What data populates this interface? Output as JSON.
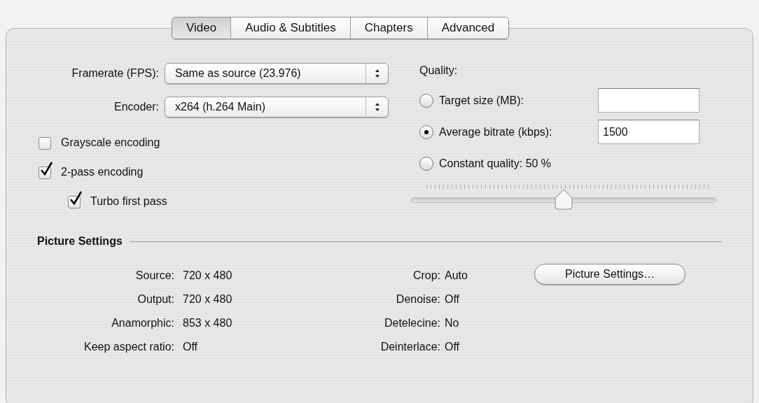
{
  "tabs": [
    {
      "label": "Video",
      "selected": true
    },
    {
      "label": "Audio & Subtitles",
      "selected": false
    },
    {
      "label": "Chapters",
      "selected": false
    },
    {
      "label": "Advanced",
      "selected": false
    }
  ],
  "popups": [
    {
      "label": "Framerate (FPS):",
      "value": "Same as source (23.976)"
    },
    {
      "label": "Encoder:",
      "value": "x264 (h.264 Main)"
    }
  ],
  "checkboxes": [
    {
      "label": "Grayscale encoding",
      "checked": false
    },
    {
      "label": "2-pass encoding",
      "checked": true,
      "children": [
        {
          "label": "Turbo first pass",
          "checked": true
        }
      ]
    }
  ],
  "quality": {
    "title": "Quality:",
    "options": [
      {
        "kind": "field",
        "label": "Target size (MB):",
        "selected": false
      },
      {
        "kind": "field",
        "label": "Average bitrate (kbps):",
        "selected": true,
        "field": "1500"
      },
      {
        "kind": "plain",
        "label": "Constant quality: 50 %",
        "selected": false
      }
    ],
    "slider": {
      "level": 0.5
    }
  },
  "picture_settings": {
    "title": "Picture Settings",
    "left": [
      {
        "label": "Source:",
        "value": "720 x 480"
      },
      {
        "label": "Output:",
        "value": "720 x 480"
      },
      {
        "label": "Anamorphic:",
        "value": "853 x 480"
      },
      {
        "label": "Keep aspect ratio:",
        "value": "Off"
      }
    ],
    "middle": [
      {
        "label": "Crop:",
        "value": "Auto"
      },
      {
        "label": "Denoise:",
        "value": "Off"
      },
      {
        "label": "Detelecine:",
        "value": "No"
      },
      {
        "label": "Deinterlace:",
        "value": "Off"
      }
    ],
    "button": "Picture Settings…"
  }
}
